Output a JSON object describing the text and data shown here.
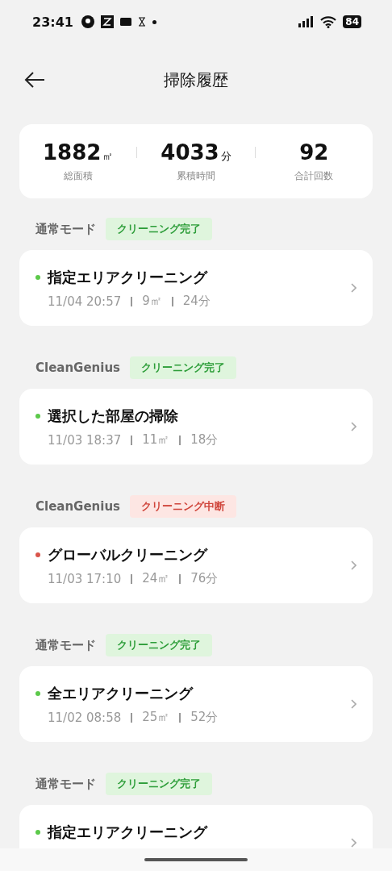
{
  "status_bar": {
    "time": "23:41",
    "battery": "84"
  },
  "header": {
    "title": "掃除履歴"
  },
  "summary": [
    {
      "value": "1882",
      "unit": "㎡",
      "label": "総面積"
    },
    {
      "value": "4033",
      "unit": "分",
      "label": "累積時間"
    },
    {
      "value": "92",
      "label": "合計回数"
    }
  ],
  "records": [
    {
      "mode": "通常モード",
      "status": "クリーニング完了",
      "kind": "complete",
      "color": "#5cc94a",
      "title": "指定エリアクリーニング",
      "date": "11/04  20:57",
      "area": "9㎡",
      "duration": "24分"
    },
    {
      "mode": "CleanGenius",
      "status": "クリーニング完了",
      "kind": "complete",
      "color": "#5cc94a",
      "title": "選択した部屋の掃除",
      "date": "11/03  18:37",
      "area": "11㎡",
      "duration": "18分"
    },
    {
      "mode": "CleanGenius",
      "status": "クリーニング中断",
      "kind": "interrupted",
      "color": "#d9544a",
      "title": "グローバルクリーニング",
      "date": "11/03  17:10",
      "area": "24㎡",
      "duration": "76分"
    },
    {
      "mode": "通常モード",
      "status": "クリーニング完了",
      "kind": "complete",
      "color": "#5cc94a",
      "title": "全エリアクリーニング",
      "date": "11/02  08:58",
      "area": "25㎡",
      "duration": "52分"
    },
    {
      "mode": "通常モード",
      "status": "クリーニング完了",
      "kind": "complete",
      "color": "#5cc94a",
      "title": "指定エリアクリーニング"
    }
  ]
}
